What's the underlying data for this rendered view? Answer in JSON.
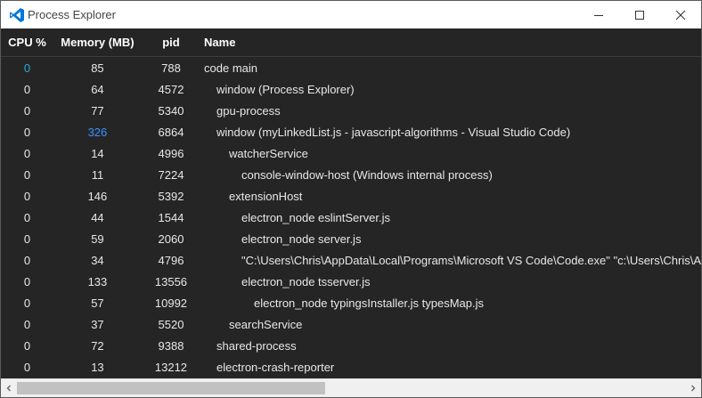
{
  "window": {
    "title": "Process Explorer",
    "app_icon": "vscode-logo-icon",
    "accent": "#0078d7"
  },
  "columns": {
    "cpu": "CPU %",
    "memory": "Memory (MB)",
    "pid": "pid",
    "name": "Name"
  },
  "rows": [
    {
      "cpu": "0",
      "memory": "85",
      "pid": "788",
      "name": "code main",
      "indent": 0,
      "cpu_highlight": true
    },
    {
      "cpu": "0",
      "memory": "64",
      "pid": "4572",
      "name": "window (Process Explorer)",
      "indent": 1
    },
    {
      "cpu": "0",
      "memory": "77",
      "pid": "5340",
      "name": "gpu-process",
      "indent": 1
    },
    {
      "cpu": "0",
      "memory": "326",
      "pid": "6864",
      "name": "window (myLinkedList.js - javascript-algorithms - Visual Studio Code)",
      "indent": 1,
      "memory_highlight": true
    },
    {
      "cpu": "0",
      "memory": "14",
      "pid": "4996",
      "name": "watcherService",
      "indent": 2
    },
    {
      "cpu": "0",
      "memory": "11",
      "pid": "7224",
      "name": "console-window-host (Windows internal process)",
      "indent": 3
    },
    {
      "cpu": "0",
      "memory": "146",
      "pid": "5392",
      "name": "extensionHost",
      "indent": 2
    },
    {
      "cpu": "0",
      "memory": "44",
      "pid": "1544",
      "name": "electron_node eslintServer.js",
      "indent": 3
    },
    {
      "cpu": "0",
      "memory": "59",
      "pid": "2060",
      "name": "electron_node server.js",
      "indent": 3
    },
    {
      "cpu": "0",
      "memory": "34",
      "pid": "4796",
      "name": "\"C:\\Users\\Chris\\AppData\\Local\\Programs\\Microsoft VS Code\\Code.exe\" \"c:\\Users\\Chris\\A",
      "indent": 3
    },
    {
      "cpu": "0",
      "memory": "133",
      "pid": "13556",
      "name": "electron_node tsserver.js",
      "indent": 3
    },
    {
      "cpu": "0",
      "memory": "57",
      "pid": "10992",
      "name": "electron_node typingsInstaller.js typesMap.js",
      "indent": 4
    },
    {
      "cpu": "0",
      "memory": "37",
      "pid": "5520",
      "name": "searchService",
      "indent": 2
    },
    {
      "cpu": "0",
      "memory": "72",
      "pid": "9388",
      "name": "shared-process",
      "indent": 1
    },
    {
      "cpu": "0",
      "memory": "13",
      "pid": "13212",
      "name": "electron-crash-reporter",
      "indent": 1
    }
  ],
  "scrollbar": {
    "left_icon": "chevron-left-icon",
    "right_icon": "chevron-right-icon",
    "position": 0
  }
}
